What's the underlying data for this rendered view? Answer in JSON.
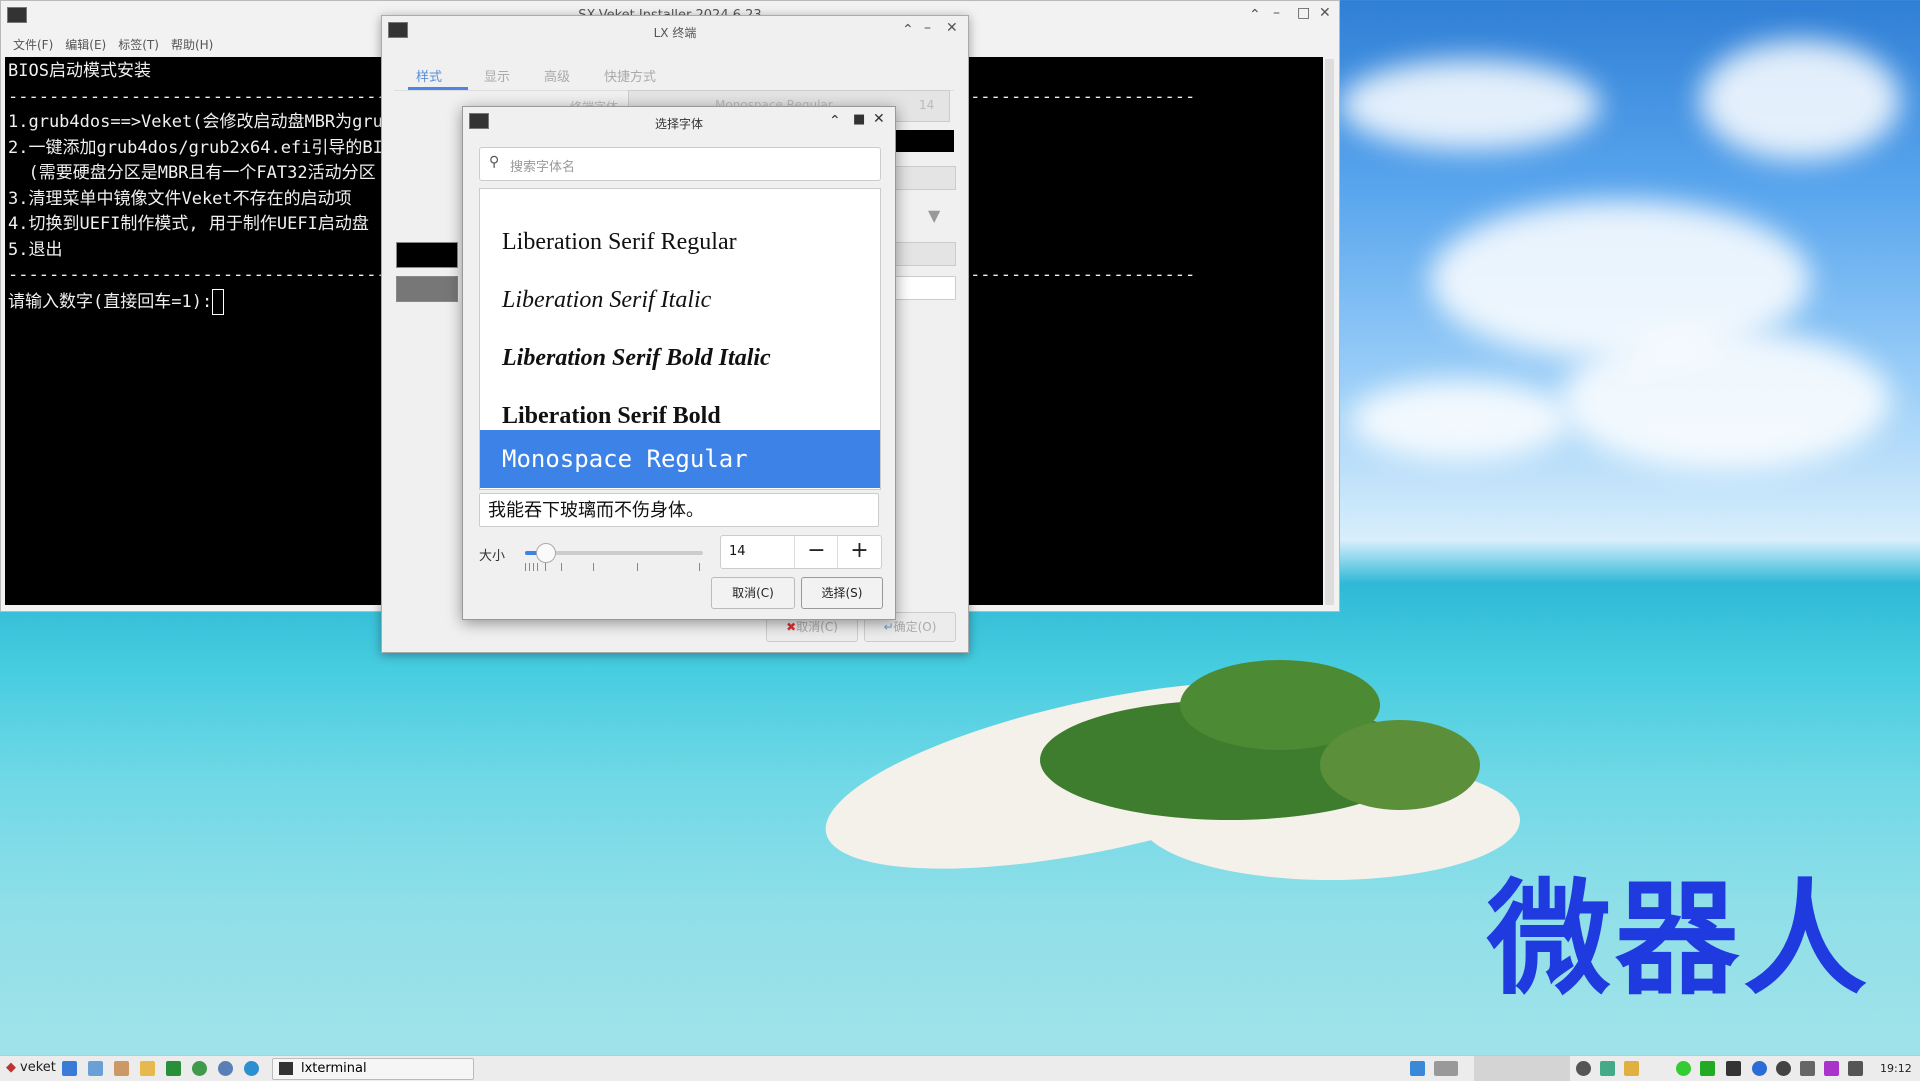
{
  "terminal": {
    "title": "SX-Veket Installer 2024.6.23",
    "menu": [
      "文件(F)",
      "编辑(E)",
      "标签(T)",
      "帮助(H)"
    ],
    "lines": [
      "BIOS启动模式安装",
      "--------------------------------------------------------------------------------------------------------------------",
      "1.grub4dos==>Veket(会修改启动盘MBR为grub4d",
      "2.一键添加grub4dos/grub2x64.efi引导的BIOS/",
      "  (需要硬盘分区是MBR且有一个FAT32活动分区",
      "3.清理菜单中镜像文件Veket不存在的启动项",
      "4.切换到UEFI制作模式, 用于制作UEFI启动盘",
      "5.退出",
      "--------------------------------------------------------------------------------------------------------------------",
      "请输入数字(直接回车=1):"
    ]
  },
  "prefs": {
    "title": "LX 终端",
    "tabs": [
      "样式",
      "显示",
      "高级",
      "快捷方式"
    ],
    "font_row_label": "终端字体",
    "font_row_value": "Monospace Regular",
    "font_row_size": "14",
    "cancel_label": "取消(C)",
    "ok_label": "确定(O)"
  },
  "font_dialog": {
    "title": "选择字体",
    "search_placeholder": "搜索字体名",
    "fonts": [
      "Liberation Serif Regular",
      "Liberation Serif Italic",
      "Liberation Serif Bold Italic",
      "Liberation Serif Bold",
      "Monospace Regular"
    ],
    "selected_index": 4,
    "preview_text": "我能吞下玻璃而不伤身体。",
    "size_label": "大小",
    "size_value": "14",
    "cancel_label": "取消(C)",
    "select_label": "选择(S)"
  },
  "taskbar": {
    "start_label": "veket",
    "task_label": "lxterminal",
    "clock": "19:12"
  },
  "desktop": {
    "watermark": "微器人"
  }
}
